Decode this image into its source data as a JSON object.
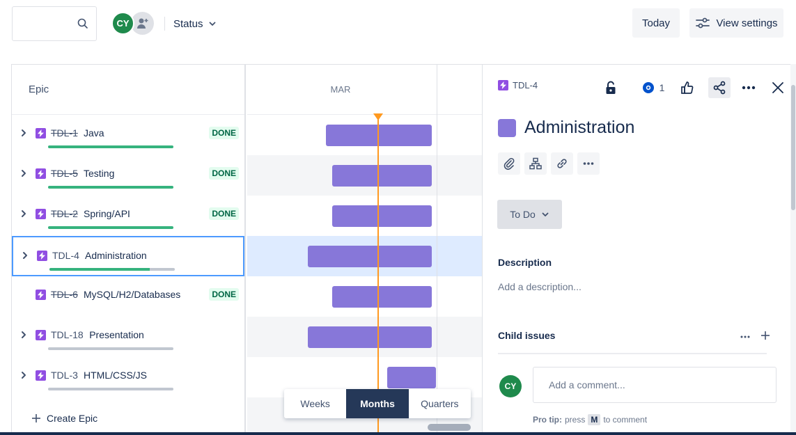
{
  "toolbar": {
    "search_placeholder": "",
    "avatar_initials": "CY",
    "status_filter_label": "Status",
    "today_label": "Today",
    "view_settings_label": "View settings"
  },
  "timeline": {
    "epic_header": "Epic",
    "month_label": "MAR",
    "create_epic_label": "Create Epic",
    "zoom_options": [
      "Weeks",
      "Months",
      "Quarters"
    ],
    "zoom_selected": "Months",
    "rows": [
      {
        "key": "TDL-1",
        "name": "Java",
        "done": true,
        "has_children": true,
        "progress": 1.0,
        "status": "DONE"
      },
      {
        "key": "TDL-5",
        "name": "Testing",
        "done": true,
        "has_children": true,
        "progress": 1.0,
        "status": "DONE"
      },
      {
        "key": "TDL-2",
        "name": "Spring/API",
        "done": true,
        "has_children": true,
        "progress": 1.0,
        "status": "DONE"
      },
      {
        "key": "TDL-4",
        "name": "Administration",
        "done": false,
        "has_children": true,
        "progress": 0.8,
        "status": ""
      },
      {
        "key": "TDL-6",
        "name": "MySQL/H2/Databases",
        "done": true,
        "has_children": false,
        "progress": null,
        "status": "DONE"
      },
      {
        "key": "TDL-18",
        "name": "Presentation",
        "done": false,
        "has_children": true,
        "progress": 0.0,
        "status": ""
      },
      {
        "key": "TDL-3",
        "name": "HTML/CSS/JS",
        "done": false,
        "has_children": true,
        "progress": 0.0,
        "status": ""
      }
    ]
  },
  "detail": {
    "issue_key": "TDL-4",
    "watch_count": "1",
    "title": "Administration",
    "status_label": "To Do",
    "description_label": "Description",
    "description_placeholder": "Add a description...",
    "child_issues_label": "Child issues",
    "comment_avatar_initials": "CY",
    "comment_placeholder": "Add a comment...",
    "pro_tip_label": "Pro tip:",
    "pro_tip_press": "press",
    "pro_tip_key": "M",
    "pro_tip_suffix": "to comment"
  },
  "colors": {
    "epic_purple": "#904ee2",
    "bar_purple": "#8777d9",
    "done_green": "#36b37e",
    "today_orange": "#ff991f",
    "avatar_green": "#1f8a4c",
    "selected_blue": "#4c9aff"
  }
}
